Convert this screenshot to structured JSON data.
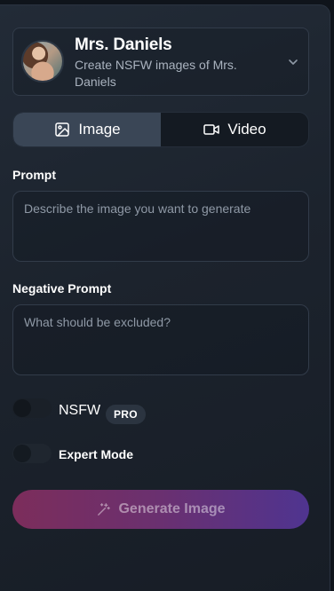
{
  "character": {
    "name": "Mrs. Daniels",
    "description": "Create NSFW images of Mrs. Daniels"
  },
  "tabs": [
    {
      "label": "Image",
      "icon": "image-icon",
      "active": true
    },
    {
      "label": "Video",
      "icon": "video-camera-icon",
      "active": false
    }
  ],
  "prompt": {
    "label": "Prompt",
    "placeholder": "Describe the image you want to generate",
    "value": ""
  },
  "negative_prompt": {
    "label": "Negative Prompt",
    "placeholder": "What should be excluded?",
    "value": ""
  },
  "nsfw_toggle": {
    "label": "NSFW",
    "badge": "PRO",
    "enabled": false
  },
  "expert_toggle": {
    "label": "Expert Mode",
    "enabled": false
  },
  "generate_button": {
    "label": "Generate Image",
    "icon": "magic-wand-icon",
    "disabled": true
  },
  "colors": {
    "panel_bg": "#1c232d",
    "tab_active": "#3a4656",
    "button_gradient_start": "#7c2d5b",
    "button_gradient_end": "#4f3490"
  }
}
